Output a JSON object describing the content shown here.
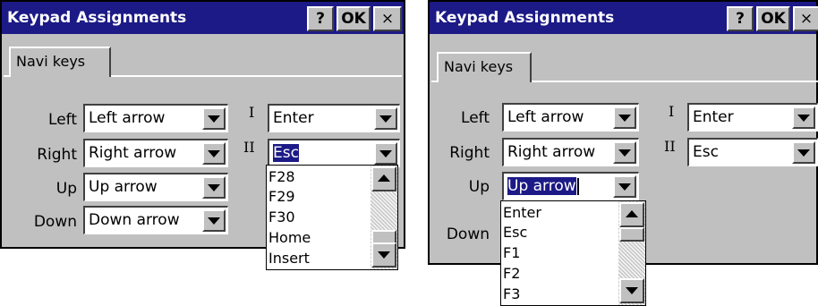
{
  "dialog_title": "Keypad Assignments",
  "help_button": "?",
  "ok_button": "OK",
  "close_button": "×",
  "tab_label": "Navi keys",
  "labels": {
    "left": "Left",
    "right": "Right",
    "up": "Up",
    "down": "Down",
    "one": "I",
    "two": "II"
  },
  "left_dialog": {
    "left_value": "Left arrow",
    "right_value": "Right arrow",
    "up_value": "Up arrow",
    "down_value": "Down arrow",
    "one_value": "Enter",
    "two_value": "Esc",
    "dropdown_items": [
      "F28",
      "F29",
      "F30",
      "Home",
      "Insert"
    ]
  },
  "right_dialog": {
    "left_value": "Left arrow",
    "right_value": "Right arrow",
    "up_value": "Up arrow",
    "one_value": "Enter",
    "two_value": "Esc",
    "dropdown_items": [
      "Enter",
      "Esc",
      "F1",
      "F2",
      "F3"
    ]
  },
  "colors": {
    "title_bar": "#1c1a86",
    "dialog_face": "#c0c0c0",
    "selection": "#1c1a86"
  }
}
